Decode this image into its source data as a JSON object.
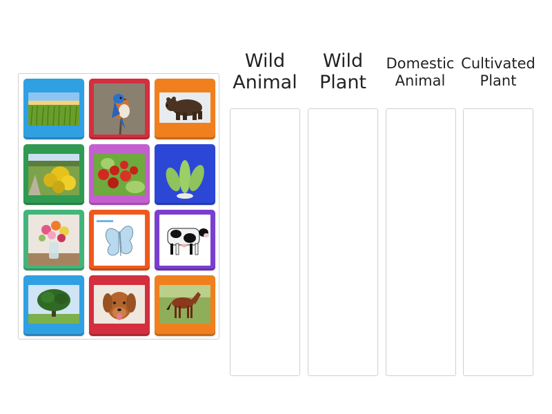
{
  "columns": [
    {
      "line1": "Wild",
      "line2": "Animal"
    },
    {
      "line1": "Wild",
      "line2": "Plant"
    },
    {
      "line1": "Domestic",
      "line2": "Animal"
    },
    {
      "line1": "Cultivated",
      "line2": "Plant"
    }
  ],
  "tiles": [
    {
      "image": "cornfield",
      "color": "#2fa0e2"
    },
    {
      "image": "bluebird",
      "color": "#d32f3f"
    },
    {
      "image": "bear",
      "color": "#f07f1d"
    },
    {
      "image": "flowering-bush",
      "color": "#2f9a52"
    },
    {
      "image": "tomatoes",
      "color": "#c45fd0"
    },
    {
      "image": "cactus",
      "color": "#2c47d6"
    },
    {
      "image": "flower-vase",
      "color": "#43b57b"
    },
    {
      "image": "butterfly-drawing",
      "color": "#ef5a1c"
    },
    {
      "image": "cow",
      "color": "#7b3fd0"
    },
    {
      "image": "tree",
      "color": "#2fa0e2"
    },
    {
      "image": "dog",
      "color": "#d32f3f"
    },
    {
      "image": "horse",
      "color": "#f07f1d"
    }
  ]
}
